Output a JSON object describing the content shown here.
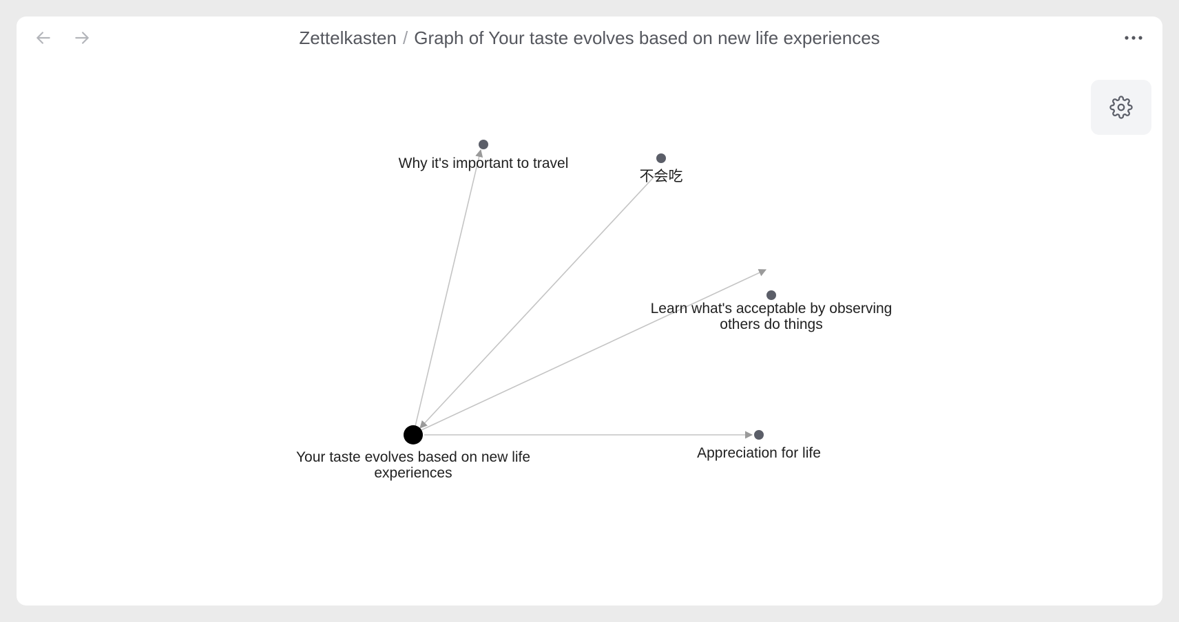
{
  "titlebar": {
    "breadcrumb_root": "Zettelkasten",
    "separator": "/",
    "page_title": "Graph of Your taste evolves based on new life experiences",
    "back_icon": "arrow-left-icon",
    "forward_icon": "arrow-right-icon",
    "more_icon": "more-horizontal-icon"
  },
  "toolbar": {
    "settings_icon": "gear-icon"
  },
  "graph": {
    "center_node": {
      "label_lines": [
        "Your taste evolves based on new life",
        "experiences"
      ]
    },
    "nodes": [
      {
        "id": "travel",
        "label_lines": [
          "Why it's important to travel"
        ]
      },
      {
        "id": "buhuichi",
        "label_lines": [
          "不会吃"
        ]
      },
      {
        "id": "acceptable",
        "label_lines": [
          "Learn what's acceptable by observing",
          "others do things"
        ]
      },
      {
        "id": "appreciation",
        "label_lines": [
          "Appreciation for life"
        ]
      }
    ],
    "colors": {
      "center_node": "#000000",
      "node": "#5b5e68",
      "edge": "#c4c4c4",
      "arrow": "#9a9a9a"
    }
  }
}
